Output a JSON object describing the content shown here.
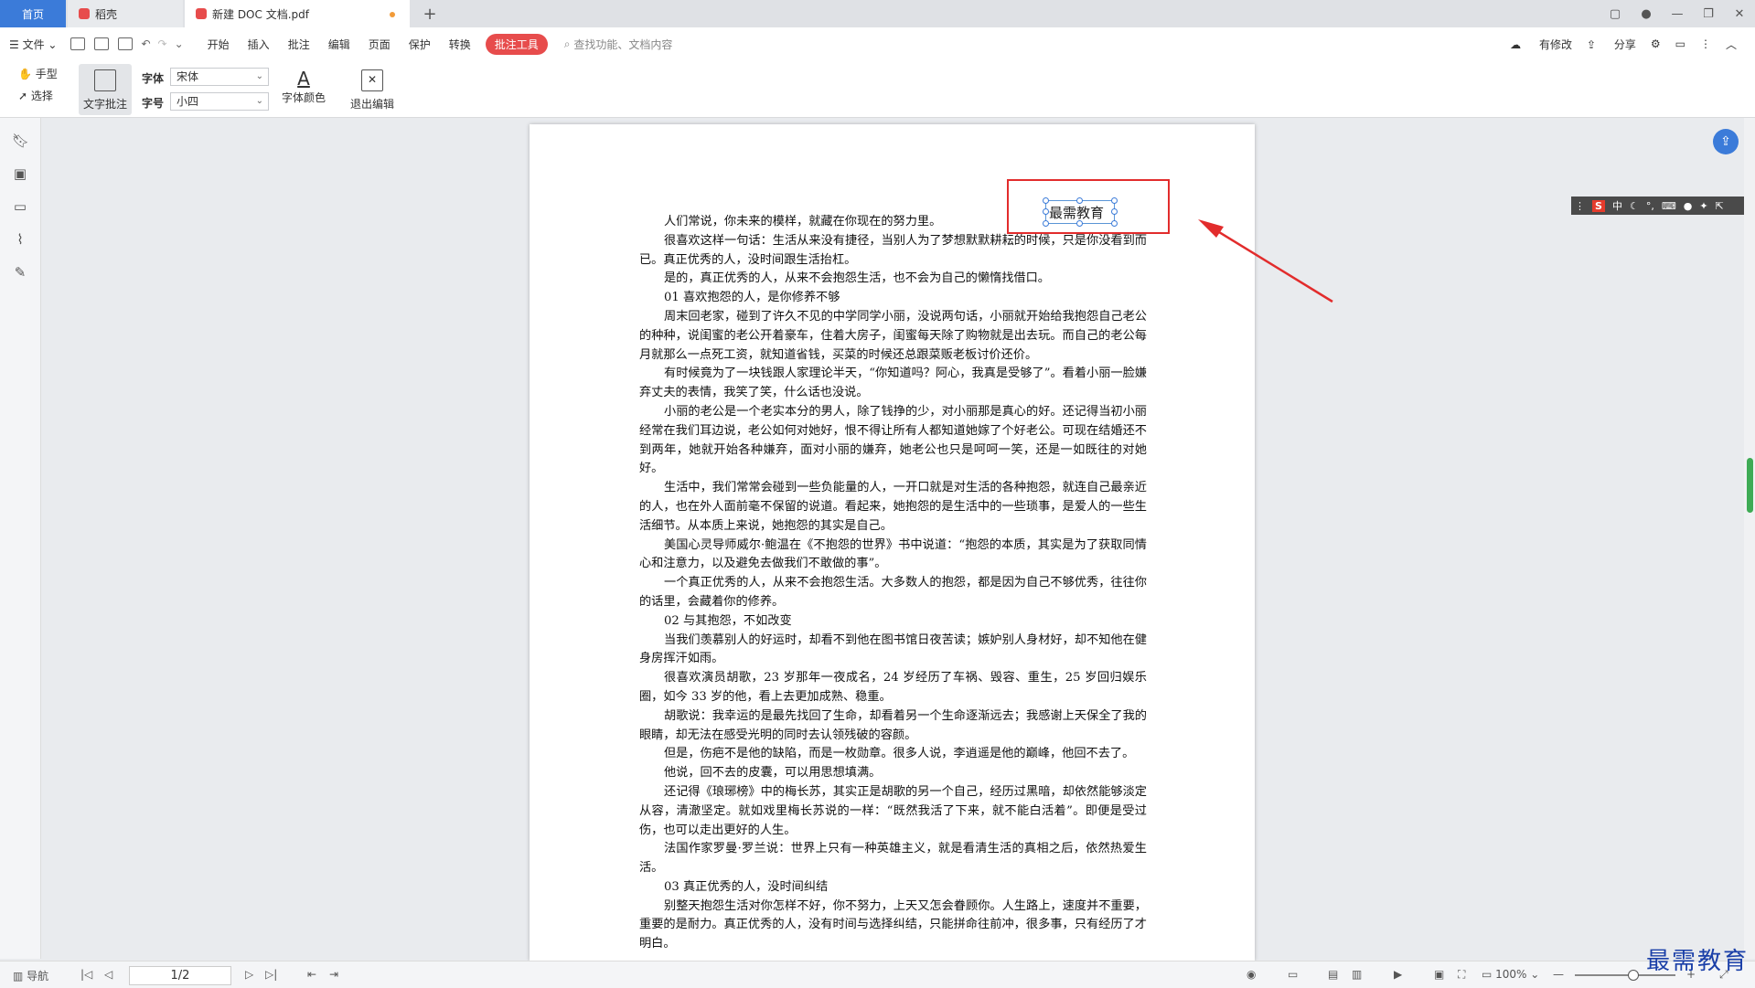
{
  "tabs": {
    "home": "首页",
    "daoke": "稻壳",
    "doc": "新建 DOC 文档.pdf",
    "add": "+"
  },
  "menu": {
    "file": "文件",
    "items": [
      "开始",
      "插入",
      "批注",
      "编辑",
      "页面",
      "保护",
      "转换"
    ],
    "active": "批注工具",
    "search_placeholder": "查找功能、文档内容",
    "right": [
      "有修改",
      "分享"
    ]
  },
  "tools": {
    "hand": "手型",
    "select": "选择",
    "text_note": "文字批注",
    "font_label": "字体",
    "font_value": "宋体",
    "size_label": "字号",
    "size_value": "小四",
    "font_color": "字体颜色",
    "exit_edit": "退出编辑"
  },
  "annotation": {
    "text": "最需教育"
  },
  "document": {
    "paragraphs": [
      "人们常说，你未来的模样，就藏在你现在的努力里。",
      "很喜欢这样一句话：生活从来没有捷径，当别人为了梦想默默耕耘的时候，只是你没看到而已。真正优秀的人，没时间跟生活抬杠。",
      "是的，真正优秀的人，从来不会抱怨生活，也不会为自己的懒惰找借口。",
      "01 喜欢抱怨的人，是你修养不够",
      "周末回老家，碰到了许久不见的中学同学小丽，没说两句话，小丽就开始给我抱怨自己老公的种种，说闺蜜的老公开着豪车，住着大房子，闺蜜每天除了购物就是出去玩。而自己的老公每月就那么一点死工资，就知道省钱，买菜的时候还总跟菜贩老板讨价还价。",
      "有时候竟为了一块钱跟人家理论半天，“你知道吗？阿心，我真是受够了”。看着小丽一脸嫌弃丈夫的表情，我笑了笑，什么话也没说。",
      "小丽的老公是一个老实本分的男人，除了钱挣的少，对小丽那是真心的好。还记得当初小丽经常在我们耳边说，老公如何对她好，恨不得让所有人都知道她嫁了个好老公。可现在结婚还不到两年，她就开始各种嫌弃，面对小丽的嫌弃，她老公也只是呵呵一笑，还是一如既往的对她好。",
      "生活中，我们常常会碰到一些负能量的人，一开口就是对生活的各种抱怨，就连自己最亲近的人，也在外人面前毫不保留的说道。看起来，她抱怨的是生活中的一些琐事，是爱人的一些生活细节。从本质上来说，她抱怨的其实是自己。",
      "美国心灵导师威尔·鲍温在《不抱怨的世界》书中说道：“抱怨的本质，其实是为了获取同情心和注意力，以及避免去做我们不敢做的事”。",
      "一个真正优秀的人，从来不会抱怨生活。大多数人的抱怨，都是因为自己不够优秀，往往你的话里，会藏着你的修养。",
      "02 与其抱怨，不如改变",
      "当我们羡慕别人的好运时，却看不到他在图书馆日夜苦读；嫉妒别人身材好，却不知他在健身房挥汗如雨。",
      "很喜欢演员胡歌，23 岁那年一夜成名，24 岁经历了车祸、毁容、重生，25 岁回归娱乐圈，如今 33 岁的他，看上去更加成熟、稳重。",
      "胡歌说：我幸运的是最先找回了生命，却看着另一个生命逐渐远去；我感谢上天保全了我的眼睛，却无法在感受光明的同时去认领残破的容颜。",
      "但是，伤疤不是他的缺陷，而是一枚勋章。很多人说，李逍遥是他的巅峰，他回不去了。",
      "他说，回不去的皮囊，可以用思想填满。",
      "还记得《琅琊榜》中的梅长苏，其实正是胡歌的另一个自己，经历过黑暗，却依然能够淡定从容，清澈坚定。就如戏里梅长苏说的一样：“既然我活了下来，就不能白活着”。即便是受过伤，也可以走出更好的人生。",
      "法国作家罗曼·罗兰说：世界上只有一种英雄主义，就是看清生活的真相之后，依然热爱生活。",
      "03 真正优秀的人，没时间纠结",
      "别整天抱怨生活对你怎样不好，你不努力，上天又怎会眷顾你。人生路上，速度并不重要，重要的是耐力。真正优秀的人，没有时间与选择纠结，只能拼命往前冲，很多事，只有经历了才明白。"
    ]
  },
  "ime": {
    "logo": "S",
    "lang": "中"
  },
  "status": {
    "nav": "导航",
    "page": "1/2",
    "zoom": "100%"
  },
  "watermark": "最需教育",
  "colors": {
    "accent": "#3b7bd9",
    "active_tab": "#e74c4c",
    "highlight_box": "#e22c2c",
    "scroll_thumb": "#3eab55"
  }
}
